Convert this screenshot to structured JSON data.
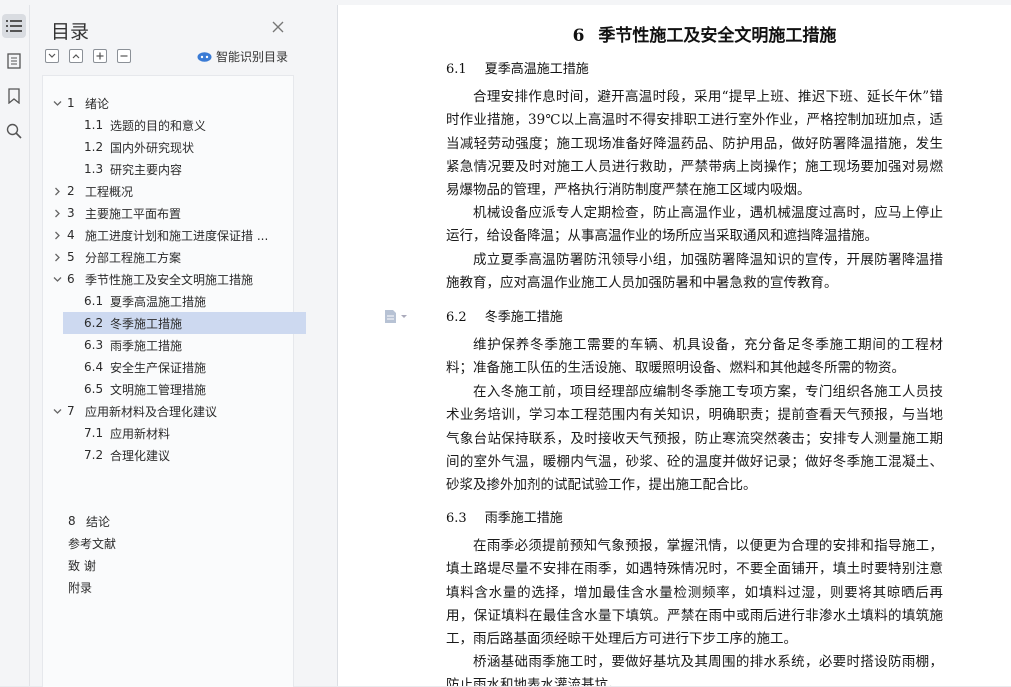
{
  "sidebar": {
    "title": "目录",
    "smart_toc_label": "智能识别目录",
    "items": [
      {
        "num": "1",
        "label": "绪论",
        "level": 1,
        "expanded": true
      },
      {
        "num": "1.1",
        "label": "选题的目的和意义",
        "level": 2
      },
      {
        "num": "1.2",
        "label": "国内外研究现状",
        "level": 2
      },
      {
        "num": "1.3",
        "label": "研究主要内容",
        "level": 2
      },
      {
        "num": "2",
        "label": "工程概况",
        "level": 1,
        "expanded": false
      },
      {
        "num": "3",
        "label": "主要施工平面布置",
        "level": 1,
        "expanded": false
      },
      {
        "num": "4",
        "label": "施工进度计划和施工进度保证措 ...",
        "level": 1,
        "expanded": false
      },
      {
        "num": "5",
        "label": "分部工程施工方案",
        "level": 1,
        "expanded": false
      },
      {
        "num": "6",
        "label": "季节性施工及安全文明施工措施",
        "level": 1,
        "expanded": true
      },
      {
        "num": "6.1",
        "label": "夏季高温施工措施",
        "level": 2
      },
      {
        "num": "6.2",
        "label": "冬季施工措施",
        "level": 2,
        "selected": true
      },
      {
        "num": "6.3",
        "label": "雨季施工措施",
        "level": 2
      },
      {
        "num": "6.4",
        "label": "安全生产保证措施",
        "level": 2
      },
      {
        "num": "6.5",
        "label": "文明施工管理措施",
        "level": 2
      },
      {
        "num": "7",
        "label": "应用新材料及合理化建议",
        "level": 1,
        "expanded": true
      },
      {
        "num": "7.1",
        "label": "应用新材料",
        "level": 2
      },
      {
        "num": "7.2",
        "label": "合理化建议",
        "level": 2
      },
      {
        "num": "8",
        "label": "结论",
        "level": 0
      },
      {
        "num": "",
        "label": "参考文献",
        "level": 0
      },
      {
        "num": "",
        "label": "致 谢",
        "level": 0
      },
      {
        "num": "",
        "label": "附录",
        "level": 0
      }
    ]
  },
  "document": {
    "chapter_num": "6",
    "chapter_title": "季节性施工及安全文明施工措施",
    "s61_num": "6.1",
    "s61_title": "夏季高温施工措施",
    "s61_p1": "合理安排作息时间，避开高温时段，采用“提早上班、推迟下班、延长午休”错时作业措施，39℃以上高温时不得安排职工进行室外作业，严格控制加班加点，适当减轻劳动强度；施工现场准备好降温药品、防护用品，做好防署降温措施，发生紧急情况要及时对施工人员进行救助，严禁带病上岗操作；施工现场要加强对易燃易爆物品的管理，严格执行消防制度严禁在施工区域内吸烟。",
    "s61_p2": "机械设备应派专人定期检查，防止高温作业，遇机械温度过高时，应马上停止运行，给设备降温；从事高温作业的场所应当采取通风和遮挡降温措施。",
    "s61_p3": "成立夏季高温防署防汛领导小组，加强防署降温知识的宣传，开展防署降温措施教育，应对高温作业施工人员加强防暑和中暑急救的宣传教育。",
    "s62_num": "6.2",
    "s62_title": "冬季施工措施",
    "s62_p1": "维护保养冬季施工需要的车辆、机具设备，充分备足冬季施工期间的工程材料；准备施工队伍的生活设施、取暖照明设备、燃料和其他越冬所需的物资。",
    "s62_p2": "在入冬施工前，项目经理部应编制冬季施工专项方案，专门组织各施工人员技术业务培训，学习本工程范围内有关知识，明确职责；提前查看天气预报，与当地气象台站保持联系，及时接收天气预报，防止寒流突然袭击；安排专人测量施工期间的室外气温，暖棚内气温，砂浆、砼的温度并做好记录；做好冬季施工混凝土、砂浆及掺外加剂的试配试验工作，提出施工配合比。",
    "s63_num": "6.3",
    "s63_title": "雨季施工措施",
    "s63_p1": "在雨季必须提前预知气象预报，掌握汛情，以便更为合理的安排和指导施工，填土路堤尽量不安排在雨季，如遇特殊情况时，不要全面铺开，填土时要特别注意填料含水量的选择，增加最佳含水量检测频率，如填料过湿，则要将其晾晒后再用，保证填料在最佳含水量下填筑。严禁在雨中或雨后进行非渗水土填料的填筑施工，雨后路基面须经晾干处理后方可进行下步工序的施工。",
    "s63_p2": "桥涵基础雨季施工时，要做好基坑及其周围的排水系统，必要时搭设防雨棚，防止雨水和地表水灌流基坑。"
  },
  "colors": {
    "selected_bg": "#cdd9f0",
    "panel_bg": "#f4f5f7",
    "accent": "#3a7bd5"
  }
}
